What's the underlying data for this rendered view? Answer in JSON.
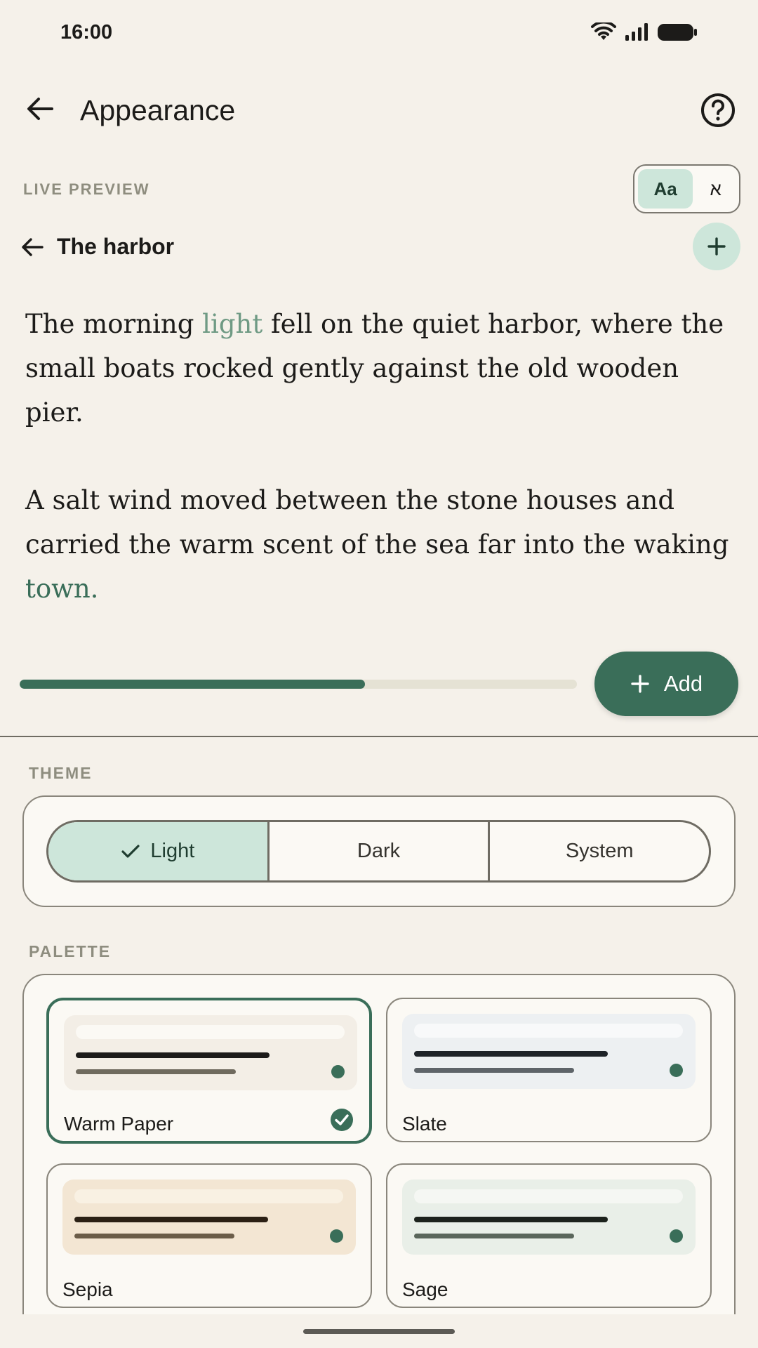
{
  "status_bar": {
    "time": "16:00"
  },
  "app_bar": {
    "title": "Appearance"
  },
  "preview": {
    "label": "LIVE PREVIEW",
    "script_options": [
      "Aa",
      "א"
    ],
    "chapter_title": "The harbor",
    "paragraph1": {
      "before": "The morning ",
      "highlight": "light",
      "after": " fell on the quiet harbor, where the small boats rocked gently against the old wooden pier."
    },
    "paragraph2": {
      "before": "A salt wind moved between the stone houses and carried the warm scent of the sea far into the waking ",
      "highlight": "town."
    },
    "progress_percent": 62,
    "add_label": "Add"
  },
  "theme": {
    "label": "THEME",
    "options": [
      "Light",
      "Dark",
      "System"
    ],
    "selected": "Light"
  },
  "palette": {
    "label": "PALETTE",
    "items": [
      {
        "name": "Warm Paper",
        "selected": true,
        "bg": "#F3EEE6",
        "bar": "#FBF9F4",
        "text": "#1C1B19",
        "sub": "#6F6A5E",
        "dot": "#3A6E59"
      },
      {
        "name": "Slate",
        "selected": false,
        "bg": "#EDF0F2",
        "bar": "#F8F9FA",
        "text": "#1E2328",
        "sub": "#5E6469",
        "dot": "#3A6E59"
      },
      {
        "name": "Sepia",
        "selected": false,
        "bg": "#F3E6D3",
        "bar": "#F9F1E3",
        "text": "#2B2014",
        "sub": "#6B5D49",
        "dot": "#3A6E59"
      },
      {
        "name": "Sage",
        "selected": false,
        "bg": "#E9EFE8",
        "bar": "#F5F7F3",
        "text": "#1C221C",
        "sub": "#5A665B",
        "dot": "#3A6E59"
      }
    ]
  },
  "colors": {
    "accent": "#3A6E59",
    "accent_container": "#CDE6DA",
    "background": "#F5F1EA"
  }
}
